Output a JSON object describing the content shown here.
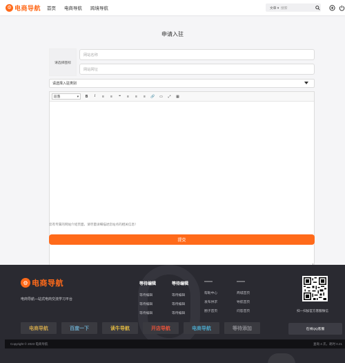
{
  "header": {
    "logo_glyph": "⚙",
    "logo_text": "电商导航",
    "nav": [
      "首页",
      "电商导航",
      "跨境导航"
    ],
    "search_select": "文章 ▾",
    "search_placeholder": "搜索",
    "icons": [
      "search-icon",
      "plus-circle-icon",
      "power-icon"
    ]
  },
  "page": {
    "title": "申请入驻",
    "thumb_label": "请选择图标",
    "name_placeholder": "网站名称",
    "url_placeholder": "网站网址",
    "category_select": "请选择入驻类别",
    "editor_format": "段落",
    "toolbar_buttons": [
      "B",
      "I",
      "≡",
      "≡",
      "❝",
      "≡",
      "≡",
      "≡",
      "🔗",
      "▭",
      "⤢",
      "▦"
    ],
    "hint": "您有专属的网站介绍页面，请尽量详细描述您站点的相关信息！",
    "submit_label": "提交"
  },
  "footer": {
    "logo_glyph": "⚙",
    "logo_text": "电商导航",
    "slogan": "电商导航—站式电商交流学习平台",
    "columns": [
      {
        "title": "等待编辑",
        "items": [
          "等待编辑",
          "等待编辑",
          "等待编辑"
        ]
      },
      {
        "title": "等待编辑",
        "items": [
          "等待编辑",
          "等待编辑",
          "等待编辑"
        ]
      },
      {
        "title": "------",
        "items": [
          "帮助中心",
          "发布供求",
          "圈子首页"
        ]
      },
      {
        "title": "------",
        "items": [
          "商城首页",
          "导航首页",
          "问答首页"
        ]
      }
    ],
    "qr_caption": "扫一扫加官方客服微信",
    "partners": [
      {
        "text": "电商导航",
        "color": "#c9a24a",
        "width": 52
      },
      {
        "text": "百度一下",
        "color": "#6aa7c7",
        "width": 52
      },
      {
        "text": "读牛导航",
        "color": "#e1b941",
        "width": 52
      },
      {
        "text": "开店导航",
        "color": "#e8533a",
        "width": 52
      },
      {
        "text": "电商导航",
        "color": "#4aa3c4",
        "width": 52
      },
      {
        "text": "等待添加",
        "color": "#8a8a90",
        "width": 52
      }
    ],
    "qq_button": "在线QQ客服",
    "copyright": "Copyright © 2023 电商导航",
    "stats": "查询 4 次，耗时 0.21"
  },
  "colors": {
    "accent": "#ff6a1a",
    "footer_bg": "#2a2a31"
  }
}
